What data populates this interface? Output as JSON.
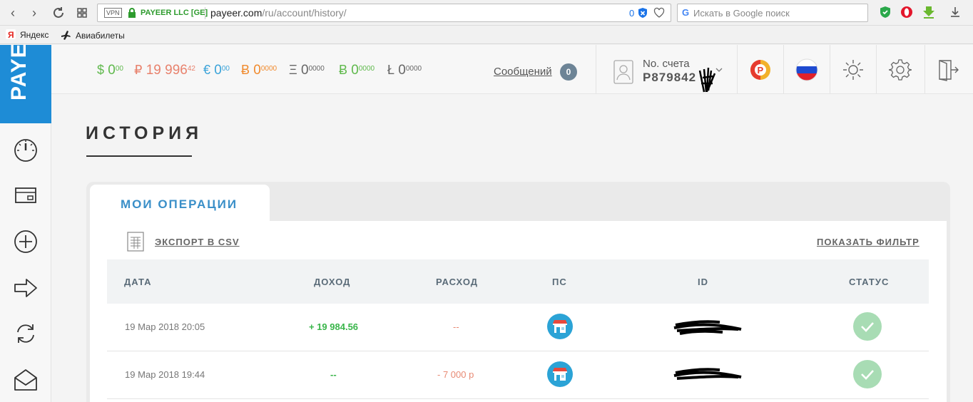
{
  "browser": {
    "vpn": "VPN",
    "site_name": "PAYEER LLC [GE]",
    "url_domain": "payeer.com",
    "url_path": "/ru/account/history/",
    "shield_count": "0",
    "search_placeholder": "Искать в Google поиск"
  },
  "bookmarks": [
    {
      "label": "Яндекс",
      "icon": "yandex-icon"
    },
    {
      "label": "Авиабилеты",
      "icon": "plane-icon"
    }
  ],
  "logo": "PAYEER",
  "balances": [
    {
      "symbol": "$",
      "int": "0",
      "frac": "00",
      "color": "#5fb94c"
    },
    {
      "symbol": "₽",
      "int": "19 996",
      "frac": "42",
      "color": "#e8826d"
    },
    {
      "symbol": "€",
      "int": "0",
      "frac": "00",
      "color": "#3aa3d9"
    },
    {
      "symbol": "Ƀ",
      "int": "0",
      "frac": "0000",
      "color": "#f08a2d"
    },
    {
      "symbol": "Ξ",
      "int": "0",
      "frac": "0000",
      "color": "#666666"
    },
    {
      "symbol": "Ƀ",
      "int": "0",
      "frac": "0000",
      "color": "#5fb94c"
    },
    {
      "symbol": "Ł",
      "int": "0",
      "frac": "0000",
      "color": "#666666"
    }
  ],
  "topbar": {
    "messages_label": "Сообщений",
    "messages_count": "0",
    "account_label": "No. счета",
    "account_number": "P879842"
  },
  "page_title": "ИСТОРИЯ",
  "tab_label": "МОИ ОПЕРАЦИИ",
  "actions": {
    "export_csv": "ЭКСПОРТ В CSV",
    "show_filter": "ПОКАЗАТЬ ФИЛЬТР"
  },
  "table": {
    "headers": [
      "ДАТА",
      "ДОХОД",
      "РАСХОД",
      "ПС",
      "ID",
      "СТАТУС"
    ],
    "rows": [
      {
        "date": "19 Мар 2018 20:05",
        "income": "+ 19 984.56",
        "expense": "--",
        "ps": "shop-icon",
        "status": "check-icon"
      },
      {
        "date": "19 Мар 2018 19:44",
        "income": "--",
        "expense": "- 7 000 р",
        "ps": "shop-icon",
        "status": "check-icon"
      }
    ]
  },
  "colors": {
    "brand": "#1e8cd6",
    "tab_accent": "#3a8fc8",
    "income": "#39b54a",
    "expense": "#e88a74",
    "status_ok": "#a8dcb4"
  }
}
